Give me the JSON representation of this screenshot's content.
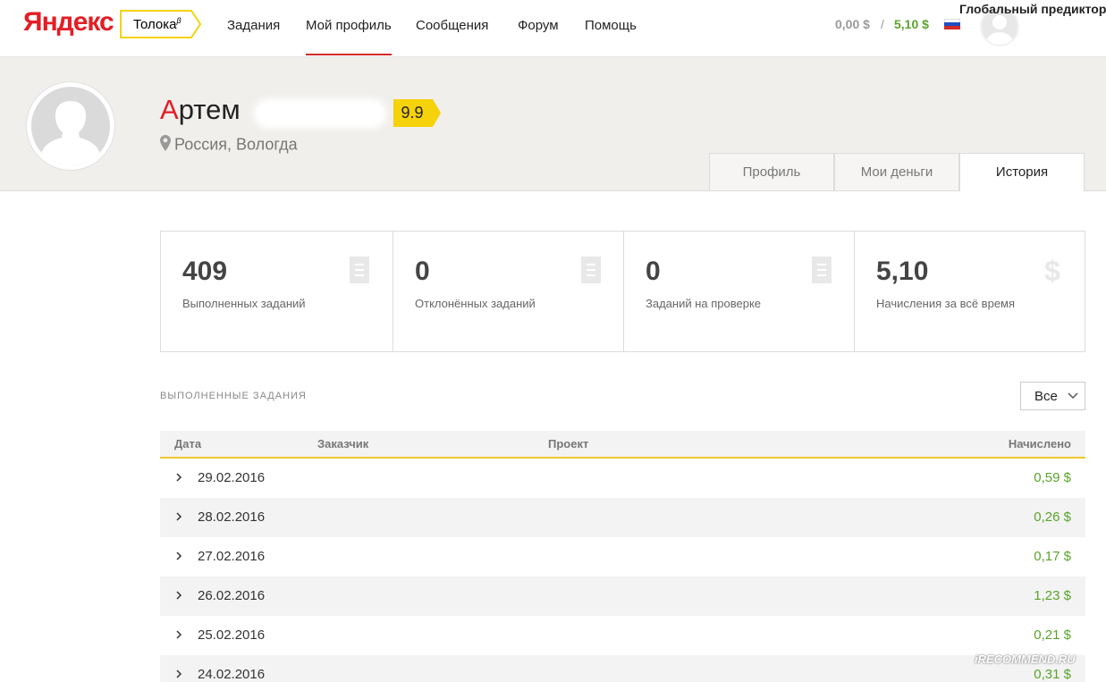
{
  "header": {
    "logo_text": "Яндекс",
    "product_badge": "Толока",
    "product_badge_sup": "β",
    "nav": [
      "Задания",
      "Мой профиль",
      "Сообщения",
      "Форум",
      "Помощь"
    ],
    "active_nav": "Мой профиль",
    "balance_current": "0,00 $",
    "balance_separator": "/",
    "balance_total": "5,10 $",
    "predictor_label": "Глобальный предиктор"
  },
  "profile": {
    "name_first_letter": "А",
    "name_rest": "ртем",
    "rating": "9.9",
    "location": "Россия, Вологда",
    "tabs": [
      "Профиль",
      "Мои деньги",
      "История"
    ],
    "active_tab": "История"
  },
  "stats": [
    {
      "value": "409",
      "label": "Выполненных заданий",
      "icon": "list-icon"
    },
    {
      "value": "0",
      "label": "Отклонённых заданий",
      "icon": "list-icon"
    },
    {
      "value": "0",
      "label": "Заданий на проверке",
      "icon": "list-icon"
    },
    {
      "value": "5,10",
      "label": "Начисления за всё время",
      "icon": "dollar-icon"
    }
  ],
  "tasks": {
    "section_title": "ВЫПОЛНЕННЫЕ ЗАДАНИЯ",
    "filter_value": "Все",
    "columns": [
      "Дата",
      "Заказчик",
      "Проект",
      "Начислено"
    ],
    "rows": [
      {
        "date": "29.02.2016",
        "amount": "0,59 $"
      },
      {
        "date": "28.02.2016",
        "amount": "0,26 $"
      },
      {
        "date": "27.02.2016",
        "amount": "0,17 $"
      },
      {
        "date": "26.02.2016",
        "amount": "1,23 $"
      },
      {
        "date": "25.02.2016",
        "amount": "0,21 $"
      },
      {
        "date": "24.02.2016",
        "amount": "0,31 $"
      }
    ]
  },
  "watermark": "iRECOMMEND.RU",
  "colors": {
    "accent_red": "#e31e24",
    "money_green": "#5aa32b",
    "badge_yellow": "#f5d20a",
    "band_bg": "#f0efec"
  }
}
